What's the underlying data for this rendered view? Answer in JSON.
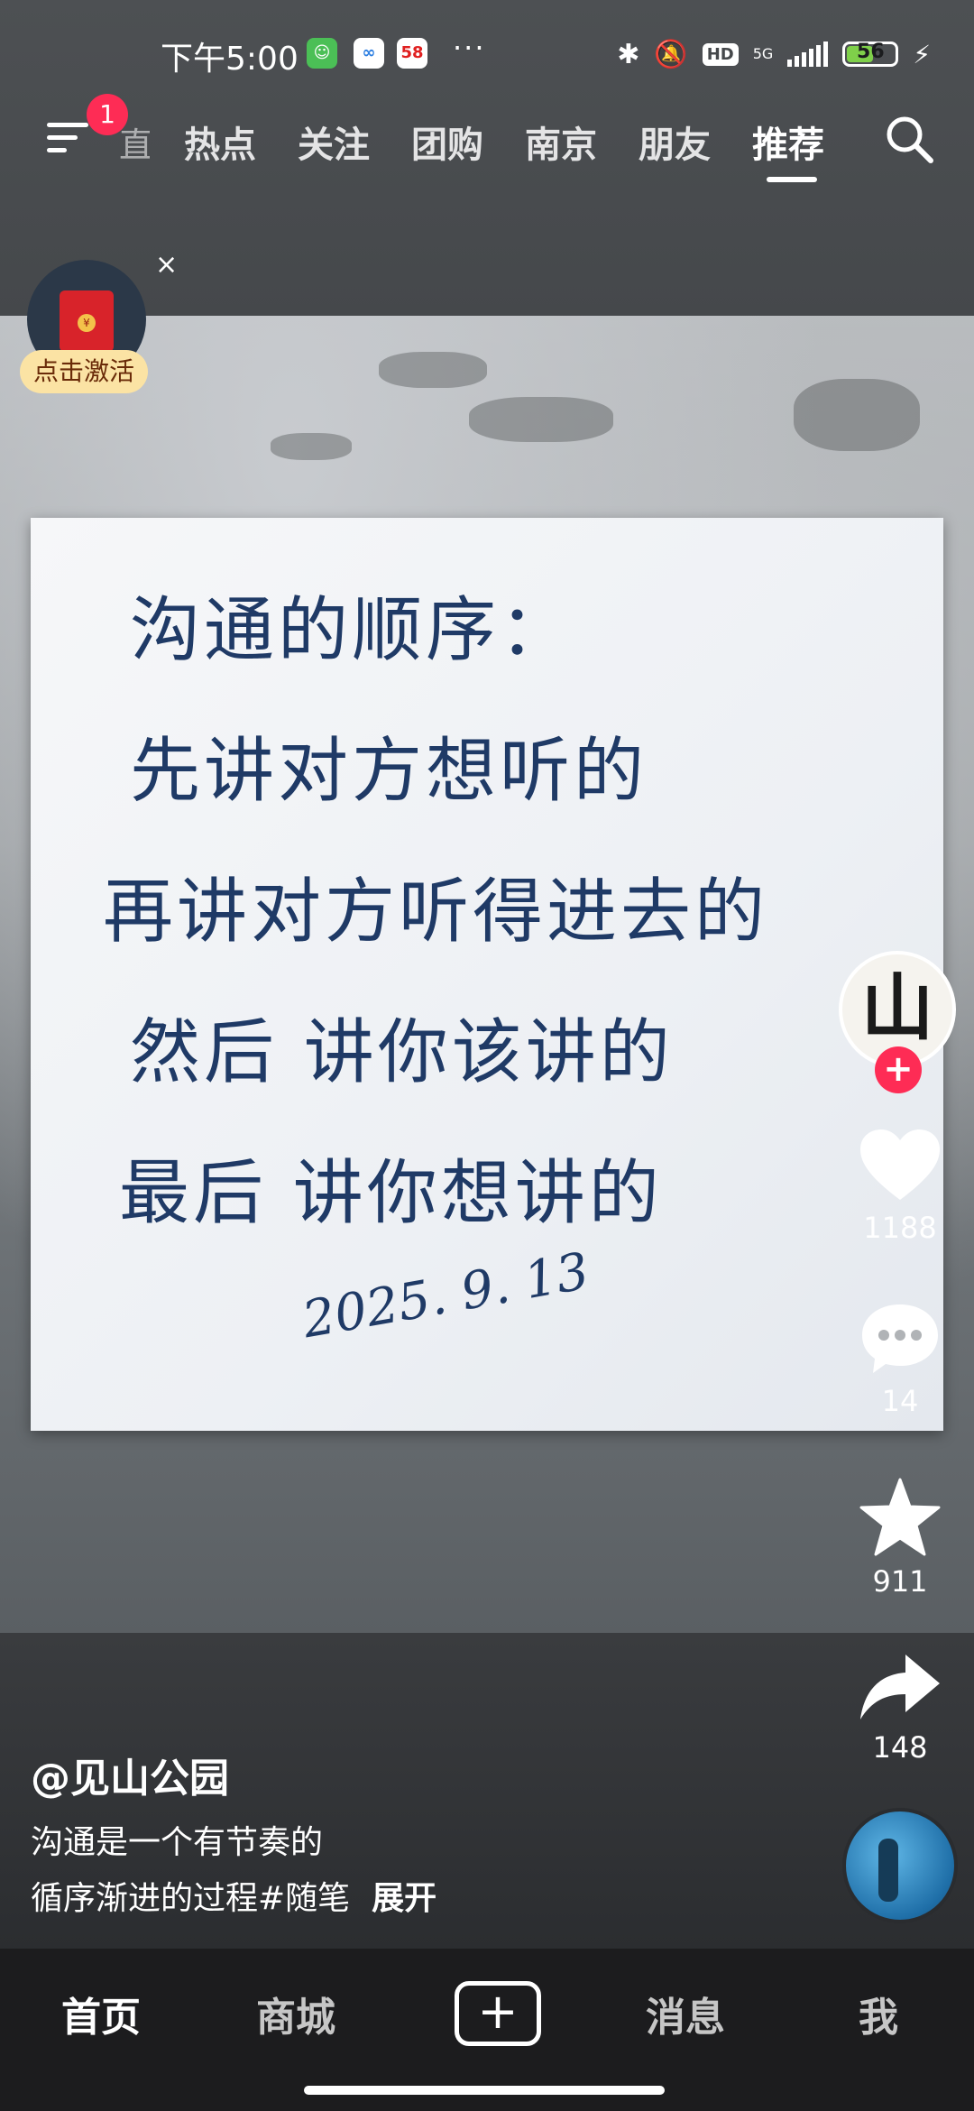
{
  "status_bar": {
    "time": "下午5:00",
    "more": "···",
    "network_label": "5G",
    "hd_label": "HD",
    "battery_level": 56,
    "battery_text": "56"
  },
  "top_nav": {
    "notification_count": "1",
    "clipped_tab": "直播",
    "tabs": [
      "热点",
      "关注",
      "团购",
      "南京",
      "朋友",
      "推荐"
    ],
    "active_tab": "推荐"
  },
  "promo": {
    "label": "点击激活",
    "close": "×",
    "seal": "¥"
  },
  "note": {
    "lines": [
      "沟通的顺序：",
      "先讲对方想听的",
      "再讲对方听得进去的",
      "然后 讲你该讲的",
      "最后 讲你想讲的"
    ],
    "date": "2025. 9. 13"
  },
  "side_actions": {
    "author_avatar_text": "山",
    "follow": "+",
    "likes": "1188",
    "comments": "14",
    "favorites": "911",
    "shares": "148"
  },
  "video_info": {
    "author": "@见山公园",
    "caption_line1": "沟通是一个有节奏的",
    "caption_line2": "循序渐进的过程#随笔",
    "expand": "展开"
  },
  "bottom_tabs": {
    "home": "首页",
    "mall": "商城",
    "create": "+",
    "messages": "消息",
    "me": "我"
  },
  "colors": {
    "accent": "#fe2c55",
    "ink": "#1f3a66",
    "battery": "#7fd04a"
  }
}
